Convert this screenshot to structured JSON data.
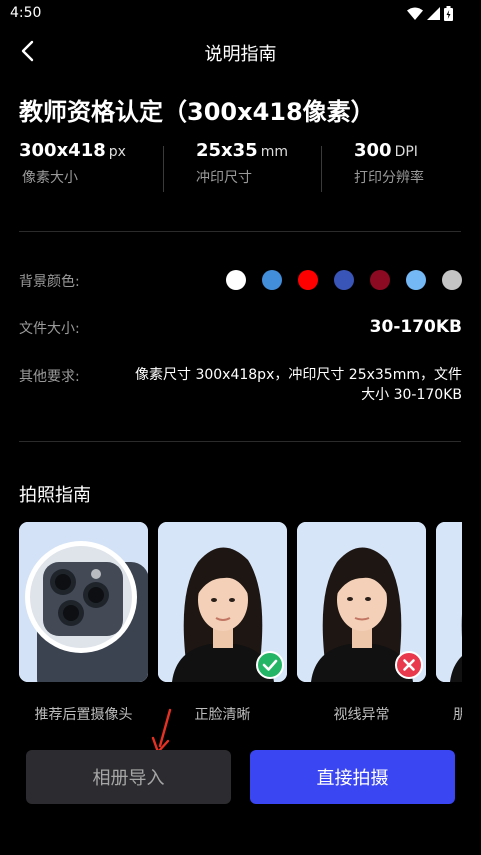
{
  "status_bar": {
    "time": "4:50"
  },
  "header": {
    "title": "说明指南"
  },
  "page": {
    "title": "教师资格认定（300x418像素）"
  },
  "specs": [
    {
      "value": "300x418",
      "unit": "px",
      "label": "像素大小"
    },
    {
      "value": "25x35",
      "unit": "mm",
      "label": "冲印尺寸"
    },
    {
      "value": "300",
      "unit": "DPI",
      "label": "打印分辨率"
    }
  ],
  "background": {
    "label": "背景颜色:",
    "colors": [
      "#ffffff",
      "#438edb",
      "#ff0000",
      "#3a55b8",
      "#8c0a22",
      "#74b9f5",
      "#c4c4c4"
    ]
  },
  "file_size": {
    "label": "文件大小:",
    "value": "30-170KB"
  },
  "other_req": {
    "label": "其他要求:",
    "value": "像素尺寸 300x418px，冲印尺寸 25x35mm，文件大小 30-170KB"
  },
  "guide": {
    "title": "拍照指南",
    "cards": [
      {
        "caption": "推荐后置摄像头"
      },
      {
        "caption": "正脸清晰",
        "status": "correct"
      },
      {
        "caption": "视线异常",
        "status": "wrong"
      },
      {
        "caption": "朋"
      }
    ]
  },
  "buttons": {
    "import": "相册导入",
    "shoot": "直接拍摄"
  }
}
